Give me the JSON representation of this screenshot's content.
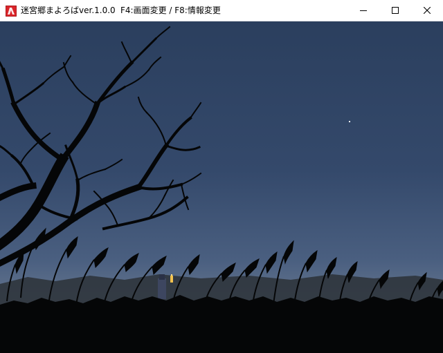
{
  "window": {
    "title": "迷宮郷まよろばver.1.0.0",
    "hint": "F4:画面変更 / F8:情報変更",
    "icon": "app-red-icon",
    "buttons": {
      "minimize": "minimize-icon",
      "maximize": "maximize-icon",
      "close": "close-icon"
    }
  },
  "scene": {
    "description_tags": [
      "night-sky",
      "bare-tree",
      "pampas-grass",
      "star",
      "character-with-lantern"
    ],
    "colors": {
      "sky_top": "#2b3f5e",
      "sky_mid": "#3a5274",
      "sky_horizon": "#6c7c92",
      "silhouette": "#050607",
      "grass_far": "#2a3036",
      "lantern": "#f2c14e"
    }
  }
}
